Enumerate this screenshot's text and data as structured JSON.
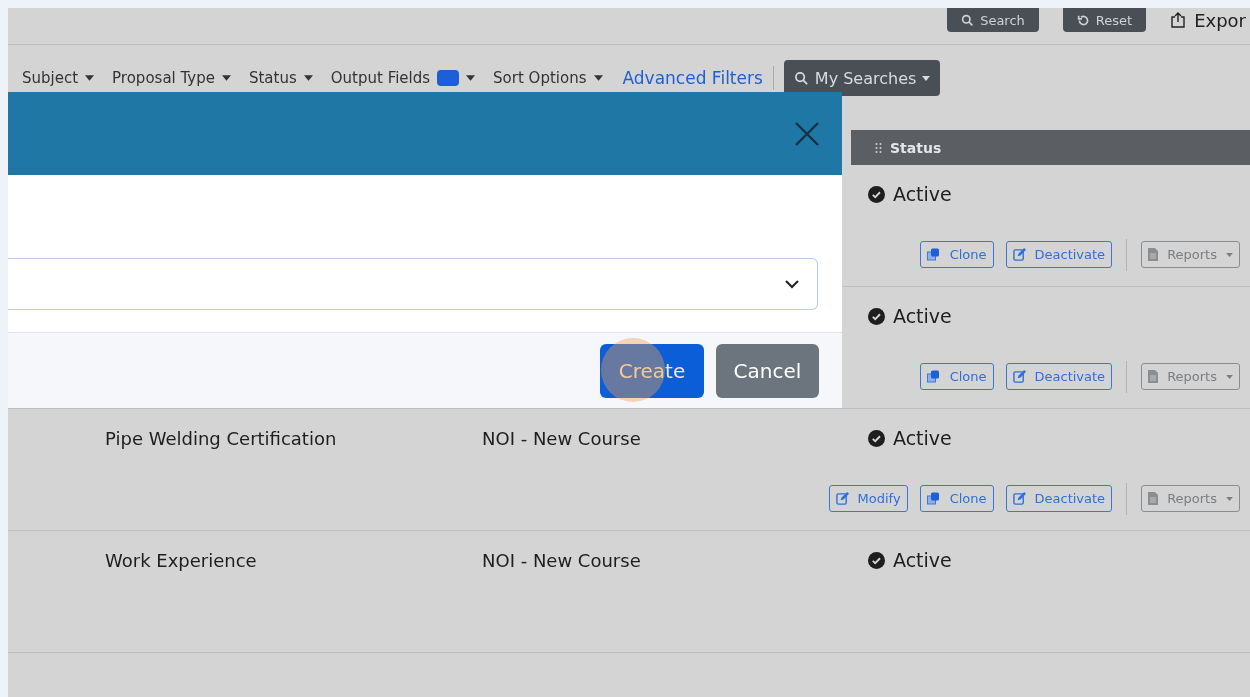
{
  "toolbar": {
    "buttons": [
      {
        "label": "Search",
        "kind": "search"
      },
      {
        "label": "Reset",
        "kind": "reset"
      },
      {
        "label": "Expor",
        "kind": "export"
      }
    ]
  },
  "filters": {
    "items": [
      {
        "label": "Subject",
        "badge": false
      },
      {
        "label": "Proposal Type",
        "badge": false
      },
      {
        "label": "Status",
        "badge": false
      },
      {
        "label": "Output Fields",
        "badge": true
      },
      {
        "label": "Sort Options",
        "badge": false
      }
    ],
    "advanced_link": "Advanced Filters",
    "my_searches": "My Searches"
  },
  "table": {
    "columns": [
      {
        "label": "Status"
      }
    ],
    "rows": [
      {
        "status": "Active",
        "actions": [
          {
            "label": "Clone",
            "kind": "clone"
          },
          {
            "label": "Deactivate",
            "kind": "edit"
          },
          {
            "label": "Reports",
            "kind": "reports"
          }
        ]
      },
      {
        "status": "Active",
        "actions": [
          {
            "label": "Clone",
            "kind": "clone"
          },
          {
            "label": "Deactivate",
            "kind": "edit"
          },
          {
            "label": "Reports",
            "kind": "reports"
          }
        ]
      },
      {
        "title": "Pipe Welding Certification",
        "type": "NOI - New Course",
        "status": "Active",
        "actions": [
          {
            "label": "Modify",
            "kind": "edit"
          },
          {
            "label": "Clone",
            "kind": "clone"
          },
          {
            "label": "Deactivate",
            "kind": "edit"
          },
          {
            "label": "Reports",
            "kind": "reports"
          }
        ]
      },
      {
        "title": "Work Experience",
        "type": "NOI - New Course",
        "status": "Active"
      }
    ]
  },
  "modal": {
    "buttons": [
      {
        "label": "Create",
        "kind": "primary"
      },
      {
        "label": "Cancel",
        "kind": "secondary"
      }
    ]
  }
}
